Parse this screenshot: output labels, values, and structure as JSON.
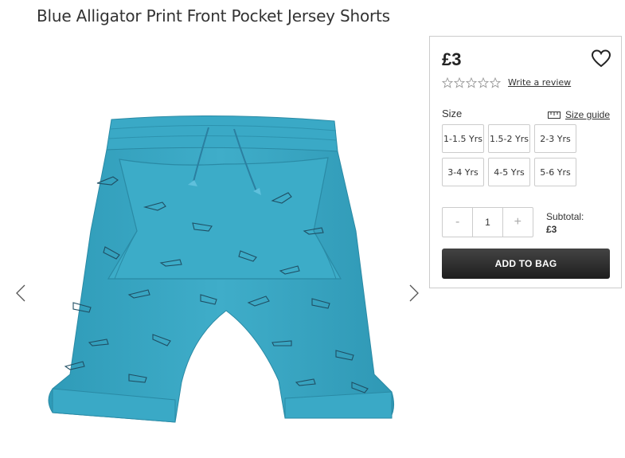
{
  "product": {
    "title": "Blue Alligator Print Front Pocket Jersey Shorts",
    "price": "£3",
    "rating_stars": 0,
    "write_review": "Write a review"
  },
  "size": {
    "label": "Size",
    "guide": "Size guide",
    "options": [
      "1-1.5 Yrs",
      "1.5-2 Yrs",
      "2-3 Yrs",
      "3-4 Yrs",
      "4-5 Yrs",
      "5-6 Yrs"
    ]
  },
  "quantity": {
    "minus": "-",
    "value": "1",
    "plus": "+"
  },
  "subtotal": {
    "label": "Subtotal:",
    "value": "£3"
  },
  "add_to_bag": "ADD TO BAG",
  "colors": {
    "shorts": "#3aa7c4",
    "button": "#2b2b2b"
  }
}
